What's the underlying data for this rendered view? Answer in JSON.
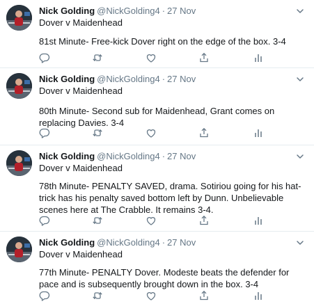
{
  "colors": {
    "text": "#14171a",
    "secondary": "#657786",
    "divider": "#e6ecf0",
    "icon": "#657786"
  },
  "tweets": [
    {
      "display_name": "Nick Golding",
      "handle": "@NickGolding4",
      "separator": "·",
      "date": "27 Nov",
      "context": "Dover v Maidenhead",
      "text": "81st Minute- Free-kick Dover right on the edge of the box. 3-4",
      "icons": [
        "reply-icon",
        "retweet-icon",
        "like-icon",
        "share-icon",
        "analytics-icon"
      ]
    },
    {
      "display_name": "Nick Golding",
      "handle": "@NickGolding4",
      "separator": "·",
      "date": "27 Nov",
      "context": "Dover v Maidenhead",
      "text": "80th Minute- Second sub for Maidenhead, Grant comes on replacing Davies. 3-4",
      "icons": [
        "reply-icon",
        "retweet-icon",
        "like-icon",
        "share-icon",
        "analytics-icon"
      ]
    },
    {
      "display_name": "Nick Golding",
      "handle": "@NickGolding4",
      "separator": "·",
      "date": "27 Nov",
      "context": "Dover v Maidenhead",
      "text": "78th Minute- PENALTY SAVED, drama. Sotiriou going for his hat-trick has his penalty saved bottom left by Dunn. Unbelievable scenes here at The Crabble. It remains 3-4.",
      "icons": [
        "reply-icon",
        "retweet-icon",
        "like-icon",
        "share-icon",
        "analytics-icon"
      ]
    },
    {
      "display_name": "Nick Golding",
      "handle": "@NickGolding4",
      "separator": "·",
      "date": "27 Nov",
      "context": "Dover v Maidenhead",
      "text": "77th Minute- PENALTY Dover. Modeste beats the defender for pace and is subsequently brought down in the box. 3-4",
      "icons": [
        "reply-icon",
        "retweet-icon",
        "like-icon",
        "share-icon",
        "analytics-icon"
      ]
    }
  ]
}
